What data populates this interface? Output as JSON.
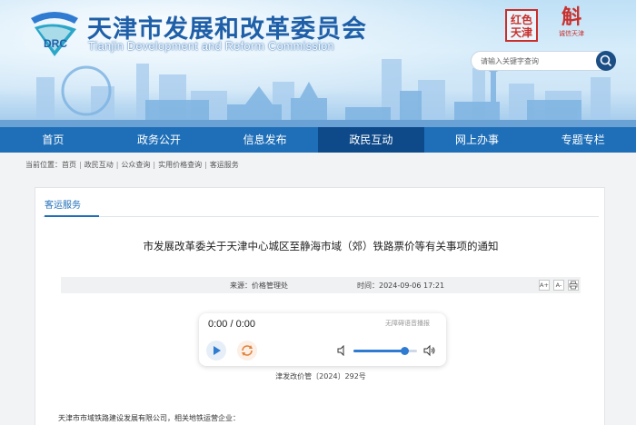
{
  "header": {
    "title": "天津市发展和改革委员会",
    "subtitle": "Tianjin Development and Reform Commission",
    "logo_text": "DRC",
    "seal1_text": "红色天津",
    "seal2_glyph": "斛",
    "seal2_small": "诚信天津",
    "search": {
      "placeholder": "请输入关键字查询"
    }
  },
  "nav": {
    "items": [
      {
        "label": "首页"
      },
      {
        "label": "政务公开"
      },
      {
        "label": "信息发布"
      },
      {
        "label": "政民互动"
      },
      {
        "label": "网上办事"
      },
      {
        "label": "专题专栏"
      }
    ],
    "active_index": 3
  },
  "breadcrumb": {
    "prefix": "当前位置：",
    "items": [
      "首页",
      "政民互动",
      "公众查询",
      "实用价格查询",
      "客运服务"
    ],
    "separator": "|"
  },
  "card": {
    "tab_label": "客运服务",
    "title": "市发展改革委关于天津中心城区至静海市域（郊）铁路票价等有关事项的通知",
    "source_label": "来源：价格管理处",
    "time_label": "时间：2024-09-06 17:21",
    "font_btns": [
      "A+",
      "A-"
    ],
    "doc_number": "津发改价管〔2024〕292号",
    "addressee": "天津市市域铁路建设发展有限公司，相关地铁运营企业："
  },
  "player": {
    "time": "0:00 / 0:00",
    "hint": "无障碍语音播报",
    "volume": 0.8
  },
  "colors": {
    "nav_bg": "#1f6fb8",
    "nav_active": "#0e4a8a",
    "title_blue": "#1e5fa8",
    "accent": "#2f7bd2"
  },
  "icons": [
    "search-icon",
    "play-icon",
    "loop-icon",
    "volume-low-icon",
    "volume-high-icon",
    "print-icon"
  ]
}
